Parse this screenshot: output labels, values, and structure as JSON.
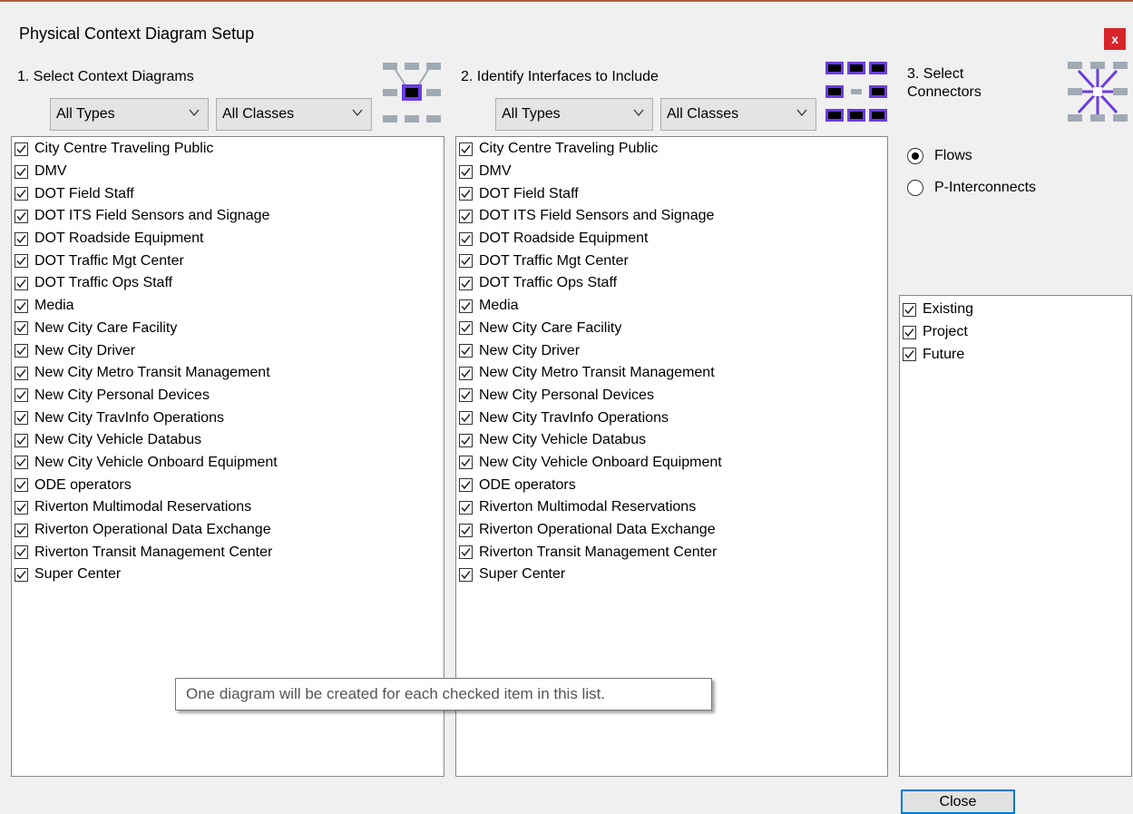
{
  "window": {
    "title": "Physical Context Diagram Setup",
    "close_symbol": "x"
  },
  "section1": {
    "label": "1. Select Context Diagrams",
    "type_filter": "All Types",
    "class_filter": "All Classes",
    "items": [
      "City Centre Traveling Public",
      "DMV",
      "DOT Field Staff",
      "DOT ITS Field Sensors and Signage",
      "DOT Roadside Equipment",
      "DOT Traffic Mgt Center",
      "DOT Traffic Ops Staff",
      "Media",
      "New City Care Facility",
      "New City Driver",
      "New City Metro Transit Management",
      "New City Personal Devices",
      "New City TravInfo Operations",
      "New City Vehicle Databus",
      "New City Vehicle Onboard Equipment",
      "ODE operators",
      "Riverton Multimodal Reservations",
      "Riverton Operational Data Exchange",
      "Riverton Transit Management Center",
      "Super Center"
    ]
  },
  "section2": {
    "label": "2. Identify Interfaces to Include",
    "type_filter": "All Types",
    "class_filter": "All Classes",
    "items": [
      "City Centre Traveling Public",
      "DMV",
      "DOT Field Staff",
      "DOT ITS Field Sensors and Signage",
      "DOT Roadside Equipment",
      "DOT Traffic Mgt Center",
      "DOT Traffic Ops Staff",
      "Media",
      "New City Care Facility",
      "New City Driver",
      "New City Metro Transit Management",
      "New City Personal Devices",
      "New City TravInfo Operations",
      "New City Vehicle Databus",
      "New City Vehicle Onboard Equipment",
      "ODE operators",
      "Riverton Multimodal Reservations",
      "Riverton Operational Data Exchange",
      "Riverton Transit Management Center",
      "Super Center"
    ]
  },
  "section3": {
    "label_line1": "3. Select",
    "label_line2": "Connectors",
    "radio_flows": "Flows",
    "radio_pinterconnects": "P-Interconnects",
    "selected": "Flows",
    "status_items": [
      "Existing",
      "Project",
      "Future"
    ]
  },
  "tooltip": "One diagram will be created for each checked item in this list.",
  "close_button": "Close",
  "colors": {
    "icon_purple": "#6a3de0",
    "icon_gray": "#a0aab4",
    "close_red": "#d9232b",
    "focus_blue": "#0078d7"
  }
}
